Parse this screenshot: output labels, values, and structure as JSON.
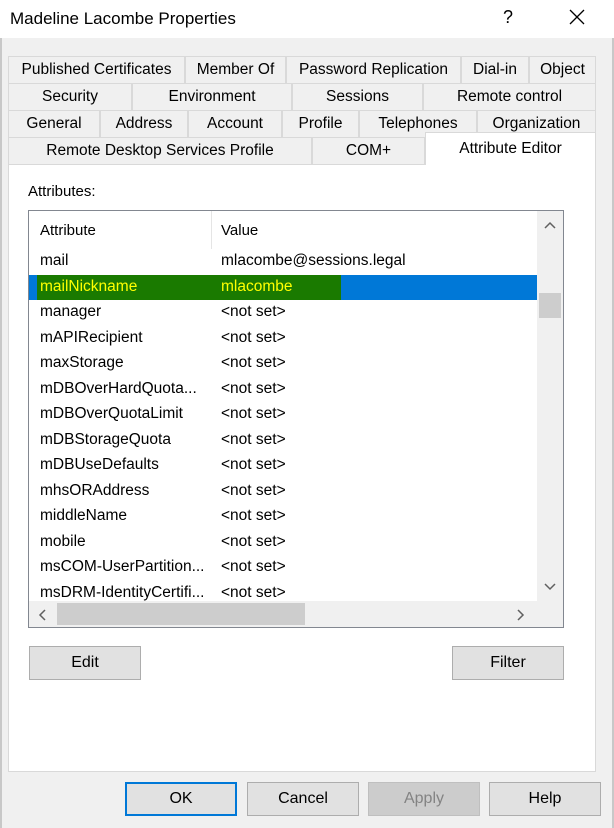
{
  "window": {
    "title": "Madeline Lacombe Properties",
    "help_glyph": "?"
  },
  "tabs": {
    "row1": [
      "Published Certificates",
      "Member Of",
      "Password Replication",
      "Dial-in",
      "Object"
    ],
    "row2": [
      "Security",
      "Environment",
      "Sessions",
      "Remote control"
    ],
    "row3": [
      "General",
      "Address",
      "Account",
      "Profile",
      "Telephones",
      "Organization"
    ],
    "row4": [
      "Remote Desktop Services Profile",
      "COM+",
      "Attribute Editor"
    ],
    "active": "Attribute Editor"
  },
  "attributes_label": "Attributes:",
  "listview": {
    "columns": [
      "Attribute",
      "Value"
    ],
    "rows": [
      {
        "attribute": "mail",
        "value": "mlacombe@sessions.legal"
      },
      {
        "attribute": "mailNickname",
        "value": "mlacombe"
      },
      {
        "attribute": "manager",
        "value": "<not set>"
      },
      {
        "attribute": "mAPIRecipient",
        "value": "<not set>"
      },
      {
        "attribute": "maxStorage",
        "value": "<not set>"
      },
      {
        "attribute": "mDBOverHardQuota...",
        "value": "<not set>"
      },
      {
        "attribute": "mDBOverQuotaLimit",
        "value": "<not set>"
      },
      {
        "attribute": "mDBStorageQuota",
        "value": "<not set>"
      },
      {
        "attribute": "mDBUseDefaults",
        "value": "<not set>"
      },
      {
        "attribute": "mhsORAddress",
        "value": "<not set>"
      },
      {
        "attribute": "middleName",
        "value": "<not set>"
      },
      {
        "attribute": "mobile",
        "value": "<not set>"
      },
      {
        "attribute": "msCOM-UserPartition...",
        "value": "<not set>"
      },
      {
        "attribute": "msDRM-IdentityCertifi...",
        "value": "<not set>"
      }
    ],
    "selected_attribute": "mailNickname",
    "selection_color": "#0078d7",
    "highlight_color": "#1a7a00",
    "highlight_text_color": "#ffff00"
  },
  "buttons": {
    "edit": "Edit",
    "filter": "Filter",
    "ok": "OK",
    "cancel": "Cancel",
    "apply": "Apply",
    "help": "Help"
  }
}
